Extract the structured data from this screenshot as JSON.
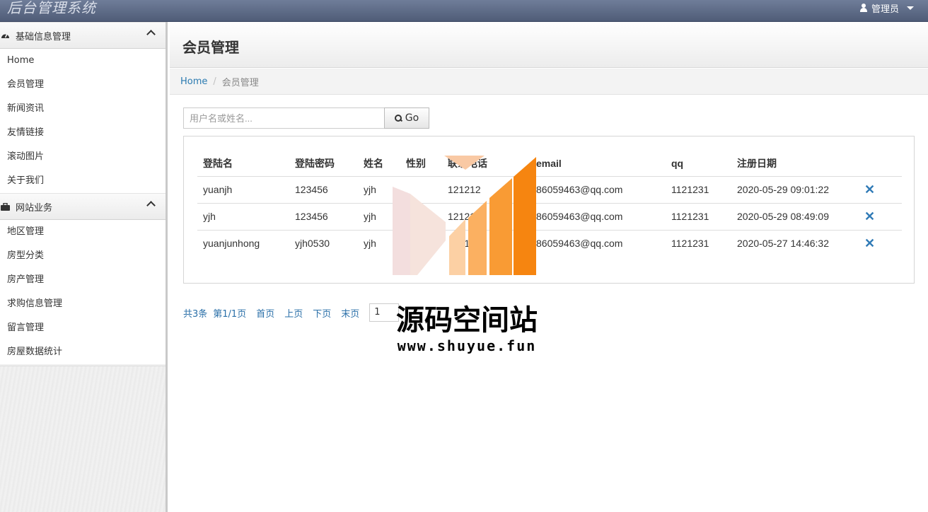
{
  "app": {
    "title": "后台管理系统"
  },
  "user_menu": {
    "label": "管理员"
  },
  "sidebar": {
    "sections": [
      {
        "title": "基础信息管理",
        "icon": "dashboard-icon",
        "items": [
          "Home",
          "会员管理",
          "新闻资讯",
          "友情链接",
          "滚动图片",
          "关于我们"
        ]
      },
      {
        "title": "网站业务",
        "icon": "briefcase-icon",
        "items": [
          "地区管理",
          "房型分类",
          "房产管理",
          "求购信息管理",
          "留言管理",
          "房屋数据统计"
        ]
      }
    ]
  },
  "main": {
    "title": "会员管理",
    "breadcrumb": {
      "home": "Home",
      "separator": "/",
      "current": "会员管理"
    },
    "search": {
      "placeholder": "用户名或姓名...",
      "value": "",
      "button": "Go"
    },
    "table": {
      "headers": [
        "登陆名",
        "登陆密码",
        "姓名",
        "性别",
        "联系电话",
        "email",
        "qq",
        "注册日期",
        ""
      ],
      "rows": [
        [
          "yuanjh",
          "123456",
          "yjh",
          "",
          "121212",
          "86059463@qq.com",
          "1121231",
          "2020-05-29 09:01:22"
        ],
        [
          "yjh",
          "123456",
          "yjh",
          "",
          "121212",
          "86059463@qq.com",
          "1121231",
          "2020-05-29 08:49:09"
        ],
        [
          "yuanjunhong",
          "yjh0530",
          "yjh",
          "",
          "3121212",
          "86059463@qq.com",
          "1121231",
          "2020-05-27 14:46:32"
        ]
      ],
      "delete_icon": "close-icon"
    },
    "pager": {
      "total": "共3条",
      "page_info": "第1/1页",
      "first": "首页",
      "prev": "上页",
      "next": "下页",
      "last": "末页",
      "page_select": "1"
    }
  },
  "watermark": {
    "text": "源码空间站",
    "url": "www.shuyue.fun"
  },
  "colors": {
    "topbar": "#5a6884",
    "link": "#2a7ab0",
    "delete": "#2f7ab6",
    "accent": "#f5a142"
  }
}
